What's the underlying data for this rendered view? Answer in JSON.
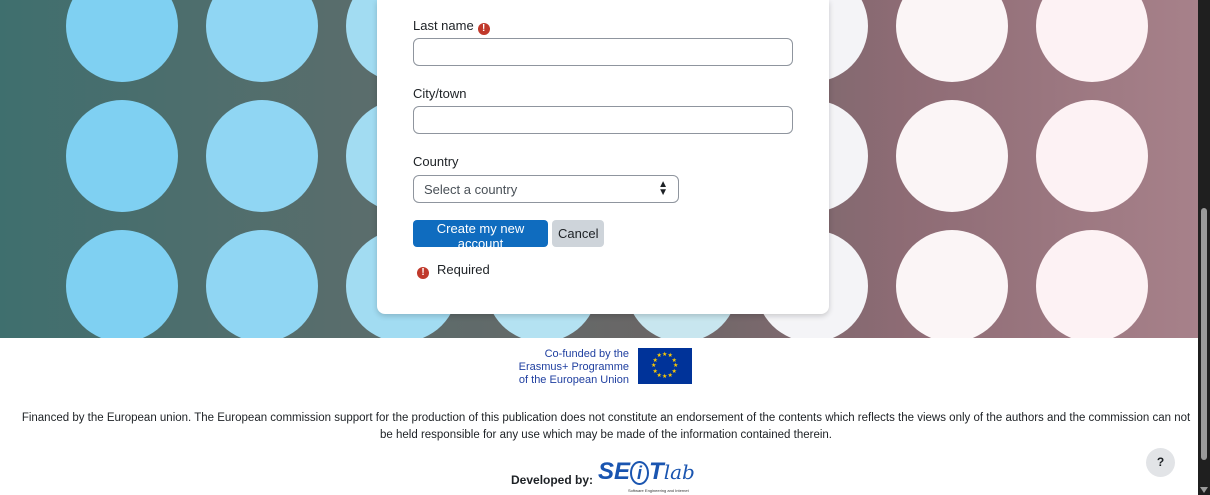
{
  "form": {
    "last_name_label": "Last name",
    "city_label": "City/town",
    "country_label": "Country",
    "country_select_value": "Select a country",
    "create_button": "Create my new account",
    "cancel_button": "Cancel",
    "required_note": "Required",
    "required_icon": "!"
  },
  "footer": {
    "cofund_line1": "Co-funded by the",
    "cofund_line2": "Erasmus+ Programme",
    "cofund_line3": "of the European Union",
    "disclaimer": "Financed by the European union. The European commission support for the production of this publication does not constitute an endorsement of the contents which reflects the views only of the authors and the commission can not be held responsible for any use which may be made of the information contained therein.",
    "developed_by": "Developed by:",
    "logo_text": "SE",
    "logo_i": "i",
    "logo_t": "T",
    "logo_lab": "lab",
    "logo_subtitle": "Software Engineering and Internet"
  },
  "help_button": "?",
  "colors": {
    "primary": "#0f6cbf",
    "required": "#c0392b",
    "eu_blue": "#003399",
    "eu_gold": "#ffcc00"
  }
}
